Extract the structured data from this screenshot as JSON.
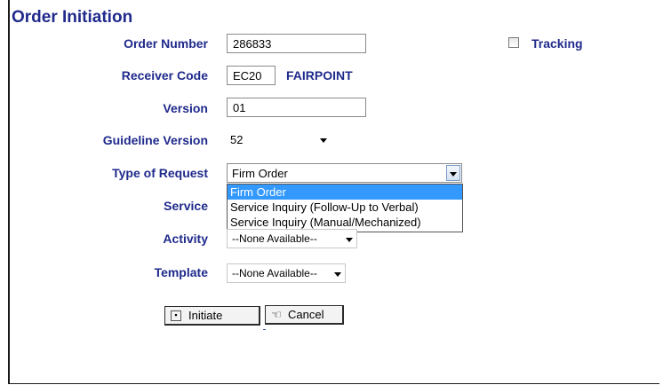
{
  "title": "Order Initiation",
  "fields": {
    "order_number": {
      "label": "Order Number",
      "value": "286833"
    },
    "tracking": {
      "label": "Tracking",
      "checked": false
    },
    "receiver_code": {
      "label": "Receiver Code",
      "value": "EC20",
      "name": "FAIRPOINT"
    },
    "version": {
      "label": "Version",
      "value": "01"
    },
    "guideline_version": {
      "label": "Guideline Version",
      "value": "52"
    },
    "type_of_request": {
      "label": "Type of Request",
      "value": "Firm Order",
      "options": [
        "Firm Order",
        "Service Inquiry (Follow-Up to Verbal)",
        "Service Inquiry (Manual/Mechanized)"
      ],
      "highlighted": "Firm Order"
    },
    "service": {
      "label": "Service"
    },
    "activity": {
      "label": "Activity",
      "value": "--None Available--"
    },
    "template": {
      "label": "Template",
      "value": "--None Available--"
    }
  },
  "buttons": {
    "initiate": {
      "label": "Initiate",
      "icon": "initiate-icon"
    },
    "cancel": {
      "label": "Cancel",
      "icon": "cancel-hand-icon"
    }
  },
  "colors": {
    "label": "#1f2a8c",
    "highlight": "#3399ff"
  }
}
